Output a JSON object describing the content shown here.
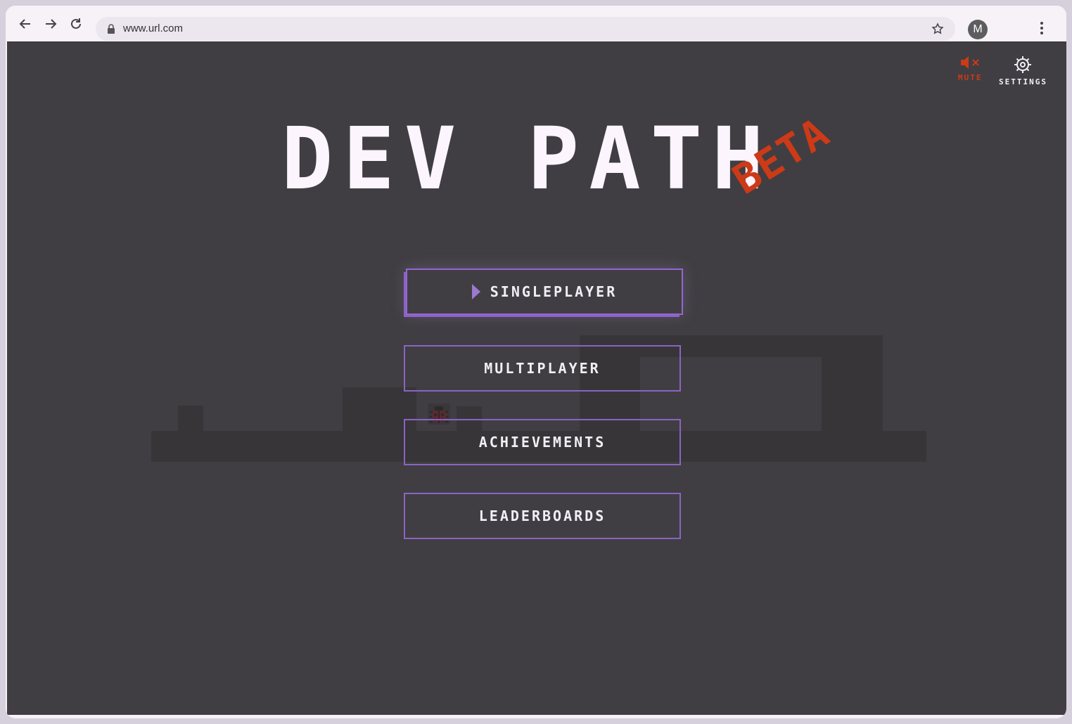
{
  "browser": {
    "url": "www.url.com",
    "profile_initial": "M"
  },
  "game": {
    "title": "DEV PATH",
    "badge": "BETA",
    "controls": {
      "mute_label": "MUTE",
      "settings_label": "SETTINGS"
    },
    "menu": [
      {
        "label": "SINGLEPLAYER",
        "selected": true
      },
      {
        "label": "MULTIPLAYER",
        "selected": false
      },
      {
        "label": "ACHIEVEMENTS",
        "selected": false
      },
      {
        "label": "LEADERBOARDS",
        "selected": false
      }
    ],
    "colors": {
      "background": "#403e42",
      "accent": "#8b63c5",
      "mute_red": "#cc3a17",
      "text": "#fcf5fd"
    }
  }
}
